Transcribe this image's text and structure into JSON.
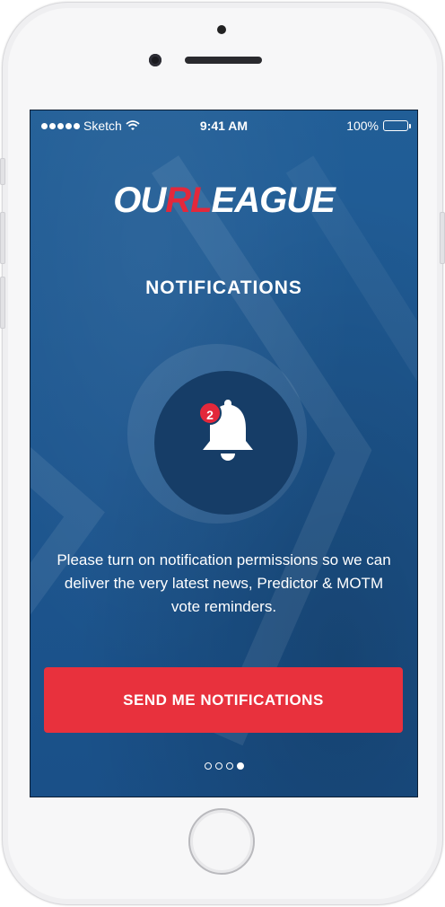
{
  "status_bar": {
    "carrier": "Sketch",
    "time": "9:41 AM",
    "battery": "100%"
  },
  "logo": {
    "part1": "OU",
    "part2": "RL",
    "part3": "EAGUE"
  },
  "screen": {
    "title": "NOTIFICATIONS",
    "badge_count": "2",
    "description": "Please turn on notification permissions so we can deliver the very latest news, Predictor & MOTM vote reminders.",
    "cta_label": "SEND ME NOTIFICATIONS"
  },
  "pager": {
    "total": 4,
    "active_index": 3
  },
  "colors": {
    "background": "#1f5a93",
    "accent": "#e8313d",
    "circle": "#163d67"
  },
  "icons": [
    "wifi-icon",
    "battery-icon",
    "bell-icon",
    "signal-dots-icon"
  ]
}
